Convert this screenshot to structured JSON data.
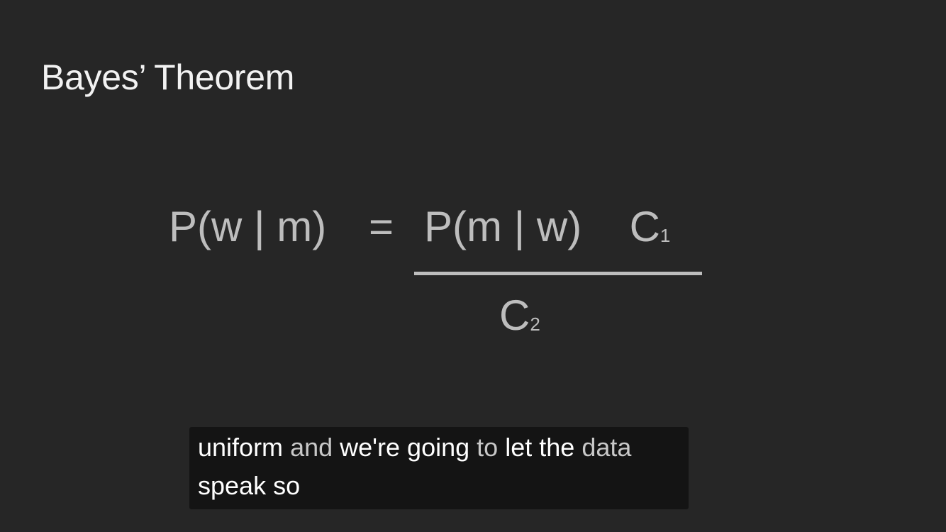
{
  "slide": {
    "title": "Bayes’ Theorem"
  },
  "equation": {
    "lhs": "P(w | m)",
    "equals": "=",
    "numerator_main": "P(m | w)",
    "numerator_const": "C",
    "numerator_const_sub": "1",
    "denominator_const": "C",
    "denominator_const_sub": "2"
  },
  "caption": {
    "line1_words": [
      "uniform",
      "and",
      "we're going",
      "to",
      "let the",
      "data"
    ],
    "line2": "speak so"
  },
  "colors": {
    "background": "#262626",
    "title": "#f2f2f2",
    "equation": "#bdbdbd",
    "caption_bg": "#141414",
    "caption_text": "#ffffff"
  }
}
